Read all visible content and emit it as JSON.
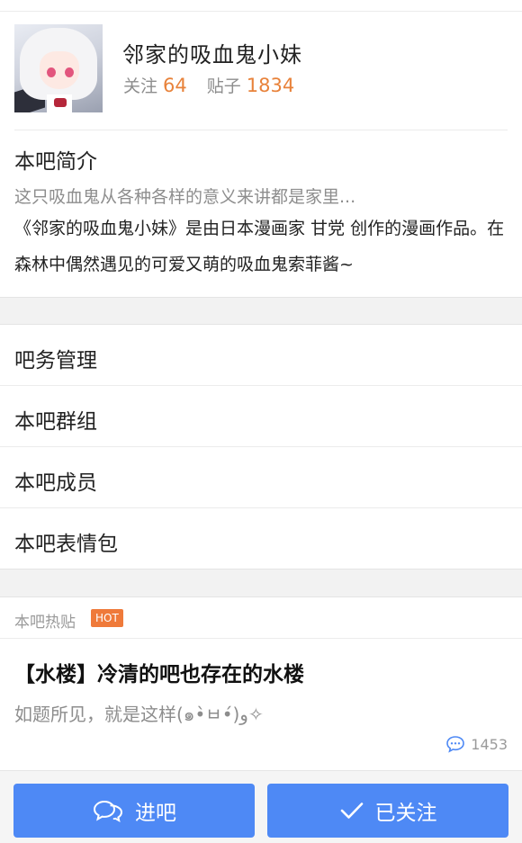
{
  "forum": {
    "name": "邻家的吸血鬼小妹",
    "follow_label": "关注",
    "follow_count": "64",
    "posts_label": "贴子",
    "posts_count": "1834"
  },
  "intro": {
    "title": "本吧简介",
    "summary": "这只吸血鬼从各种各样的意义来讲都是家里...",
    "body": "《邻家的吸血鬼小妹》是由日本漫画家 甘党 创作的漫画作品。在森林中偶然遇见的可爱又萌的吸血鬼索菲酱~"
  },
  "menu": {
    "items": [
      {
        "label": "吧务管理"
      },
      {
        "label": "本吧群组"
      },
      {
        "label": "本吧成员"
      },
      {
        "label": "本吧表情包"
      }
    ]
  },
  "hot": {
    "label": "本吧热贴",
    "badge": "HOT",
    "post": {
      "title": "【水楼】冷清的吧也存在的水楼",
      "excerpt": "如题所见，就是这样(๑•̀ㅂ•́)و✧",
      "reply_count": "1453"
    }
  },
  "actions": {
    "enter_label": "进吧",
    "followed_label": "已关注"
  },
  "colors": {
    "accent_orange": "#e8823a",
    "button_blue": "#4e89f5",
    "hot_badge": "#ef7a3a"
  },
  "icons": {
    "enter": "chat-bubbles-icon",
    "followed": "checkmark-icon",
    "reply": "comment-icon"
  }
}
